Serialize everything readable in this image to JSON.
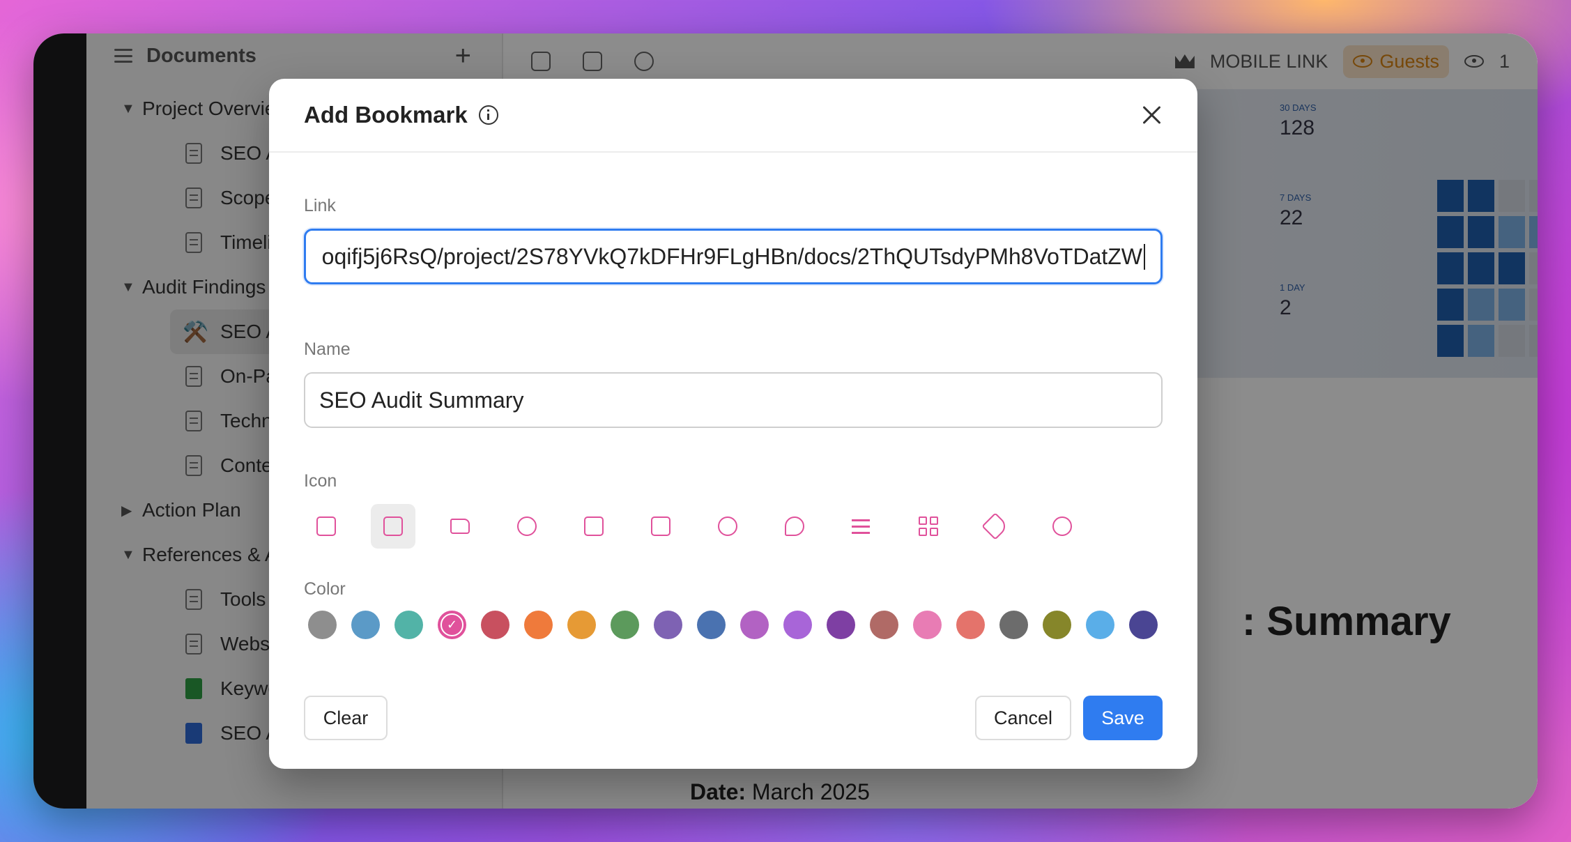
{
  "sidebar": {
    "title": "Documents",
    "items": [
      {
        "type": "group",
        "label": "Project Overvie",
        "open": true
      },
      {
        "type": "leaf",
        "label": "SEO Audi"
      },
      {
        "type": "leaf",
        "label": "Scope &"
      },
      {
        "type": "leaf",
        "label": "Timeline"
      },
      {
        "type": "group",
        "label": "Audit Findings",
        "open": true
      },
      {
        "type": "active",
        "label": "SEO Audi",
        "emoji": "⚒️"
      },
      {
        "type": "leaf",
        "label": "On-Page"
      },
      {
        "type": "leaf",
        "label": "Technical"
      },
      {
        "type": "leaf",
        "label": "Content &"
      },
      {
        "type": "group",
        "label": "Action Plan",
        "open": false
      },
      {
        "type": "group",
        "label": "References & A",
        "open": true
      },
      {
        "type": "leaf",
        "label": "Tools & D"
      },
      {
        "type": "leaf",
        "label": "Website A"
      },
      {
        "type": "sheet",
        "label": "Keyword"
      },
      {
        "type": "gdoc",
        "label": "SEO Audi"
      }
    ]
  },
  "topbar": {
    "mobile_link": "MOBILE LINK",
    "guests": "Guests",
    "viewers": "1"
  },
  "cover": {
    "stats": [
      {
        "label": "30 DAYS",
        "value": "128"
      },
      {
        "label": "7 DAYS",
        "value": "22"
      },
      {
        "label": "1 DAY",
        "value": "2"
      }
    ]
  },
  "doc": {
    "title_fragment": ": Summary",
    "date_label": "Date:",
    "date_value": "March 2025"
  },
  "modal": {
    "title": "Add Bookmark",
    "link_label": "Link",
    "link_value": "oqifj5j6RsQ/project/2S78YVkQ7kDFHr9FLgHBn/docs/2ThQUTsdyPMh8VoTDatZW",
    "name_label": "Name",
    "name_value": "SEO Audit Summary",
    "icon_label": "Icon",
    "icons": [
      "external-link-icon",
      "document-icon",
      "folder-icon",
      "user-icon",
      "file-text-icon",
      "calendar-icon",
      "check-circle-icon",
      "chat-bubble-icon",
      "list-icon",
      "grid-icon",
      "tag-icon",
      "users-icon"
    ],
    "selected_icon": "document-icon",
    "color_label": "Color",
    "colors": [
      "#8e8e8e",
      "#5b9ac7",
      "#52b3a7",
      "#e0519b",
      "#c8505f",
      "#ef7a3b",
      "#e69a35",
      "#5c9a5c",
      "#7e62b3",
      "#4a72b0",
      "#b262c3",
      "#a865d8",
      "#7e3fa3",
      "#b06a66",
      "#e87cb4",
      "#e4736b",
      "#6c6c6c",
      "#86862a",
      "#5aaee8",
      "#4a4593"
    ],
    "selected_color": "#e0519b",
    "clear_label": "Clear",
    "cancel_label": "Cancel",
    "save_label": "Save"
  }
}
